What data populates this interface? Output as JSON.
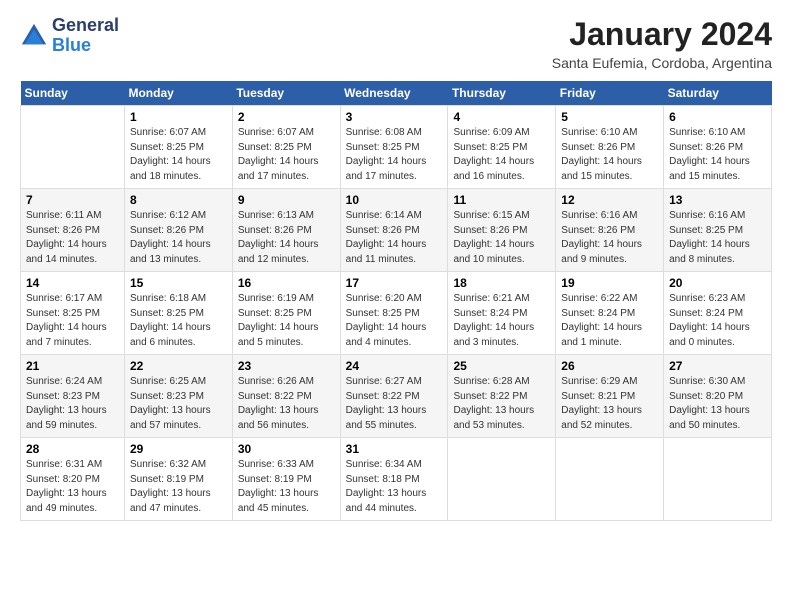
{
  "logo": {
    "line1": "General",
    "line2": "Blue"
  },
  "title": "January 2024",
  "subtitle": "Santa Eufemia, Cordoba, Argentina",
  "days_header": [
    "Sunday",
    "Monday",
    "Tuesday",
    "Wednesday",
    "Thursday",
    "Friday",
    "Saturday"
  ],
  "weeks": [
    [
      {
        "num": "",
        "info": ""
      },
      {
        "num": "1",
        "info": "Sunrise: 6:07 AM\nSunset: 8:25 PM\nDaylight: 14 hours\nand 18 minutes."
      },
      {
        "num": "2",
        "info": "Sunrise: 6:07 AM\nSunset: 8:25 PM\nDaylight: 14 hours\nand 17 minutes."
      },
      {
        "num": "3",
        "info": "Sunrise: 6:08 AM\nSunset: 8:25 PM\nDaylight: 14 hours\nand 17 minutes."
      },
      {
        "num": "4",
        "info": "Sunrise: 6:09 AM\nSunset: 8:25 PM\nDaylight: 14 hours\nand 16 minutes."
      },
      {
        "num": "5",
        "info": "Sunrise: 6:10 AM\nSunset: 8:26 PM\nDaylight: 14 hours\nand 15 minutes."
      },
      {
        "num": "6",
        "info": "Sunrise: 6:10 AM\nSunset: 8:26 PM\nDaylight: 14 hours\nand 15 minutes."
      }
    ],
    [
      {
        "num": "7",
        "info": "Sunrise: 6:11 AM\nSunset: 8:26 PM\nDaylight: 14 hours\nand 14 minutes."
      },
      {
        "num": "8",
        "info": "Sunrise: 6:12 AM\nSunset: 8:26 PM\nDaylight: 14 hours\nand 13 minutes."
      },
      {
        "num": "9",
        "info": "Sunrise: 6:13 AM\nSunset: 8:26 PM\nDaylight: 14 hours\nand 12 minutes."
      },
      {
        "num": "10",
        "info": "Sunrise: 6:14 AM\nSunset: 8:26 PM\nDaylight: 14 hours\nand 11 minutes."
      },
      {
        "num": "11",
        "info": "Sunrise: 6:15 AM\nSunset: 8:26 PM\nDaylight: 14 hours\nand 10 minutes."
      },
      {
        "num": "12",
        "info": "Sunrise: 6:16 AM\nSunset: 8:26 PM\nDaylight: 14 hours\nand 9 minutes."
      },
      {
        "num": "13",
        "info": "Sunrise: 6:16 AM\nSunset: 8:25 PM\nDaylight: 14 hours\nand 8 minutes."
      }
    ],
    [
      {
        "num": "14",
        "info": "Sunrise: 6:17 AM\nSunset: 8:25 PM\nDaylight: 14 hours\nand 7 minutes."
      },
      {
        "num": "15",
        "info": "Sunrise: 6:18 AM\nSunset: 8:25 PM\nDaylight: 14 hours\nand 6 minutes."
      },
      {
        "num": "16",
        "info": "Sunrise: 6:19 AM\nSunset: 8:25 PM\nDaylight: 14 hours\nand 5 minutes."
      },
      {
        "num": "17",
        "info": "Sunrise: 6:20 AM\nSunset: 8:25 PM\nDaylight: 14 hours\nand 4 minutes."
      },
      {
        "num": "18",
        "info": "Sunrise: 6:21 AM\nSunset: 8:24 PM\nDaylight: 14 hours\nand 3 minutes."
      },
      {
        "num": "19",
        "info": "Sunrise: 6:22 AM\nSunset: 8:24 PM\nDaylight: 14 hours\nand 1 minute."
      },
      {
        "num": "20",
        "info": "Sunrise: 6:23 AM\nSunset: 8:24 PM\nDaylight: 14 hours\nand 0 minutes."
      }
    ],
    [
      {
        "num": "21",
        "info": "Sunrise: 6:24 AM\nSunset: 8:23 PM\nDaylight: 13 hours\nand 59 minutes."
      },
      {
        "num": "22",
        "info": "Sunrise: 6:25 AM\nSunset: 8:23 PM\nDaylight: 13 hours\nand 57 minutes."
      },
      {
        "num": "23",
        "info": "Sunrise: 6:26 AM\nSunset: 8:22 PM\nDaylight: 13 hours\nand 56 minutes."
      },
      {
        "num": "24",
        "info": "Sunrise: 6:27 AM\nSunset: 8:22 PM\nDaylight: 13 hours\nand 55 minutes."
      },
      {
        "num": "25",
        "info": "Sunrise: 6:28 AM\nSunset: 8:22 PM\nDaylight: 13 hours\nand 53 minutes."
      },
      {
        "num": "26",
        "info": "Sunrise: 6:29 AM\nSunset: 8:21 PM\nDaylight: 13 hours\nand 52 minutes."
      },
      {
        "num": "27",
        "info": "Sunrise: 6:30 AM\nSunset: 8:20 PM\nDaylight: 13 hours\nand 50 minutes."
      }
    ],
    [
      {
        "num": "28",
        "info": "Sunrise: 6:31 AM\nSunset: 8:20 PM\nDaylight: 13 hours\nand 49 minutes."
      },
      {
        "num": "29",
        "info": "Sunrise: 6:32 AM\nSunset: 8:19 PM\nDaylight: 13 hours\nand 47 minutes."
      },
      {
        "num": "30",
        "info": "Sunrise: 6:33 AM\nSunset: 8:19 PM\nDaylight: 13 hours\nand 45 minutes."
      },
      {
        "num": "31",
        "info": "Sunrise: 6:34 AM\nSunset: 8:18 PM\nDaylight: 13 hours\nand 44 minutes."
      },
      {
        "num": "",
        "info": ""
      },
      {
        "num": "",
        "info": ""
      },
      {
        "num": "",
        "info": ""
      }
    ]
  ]
}
